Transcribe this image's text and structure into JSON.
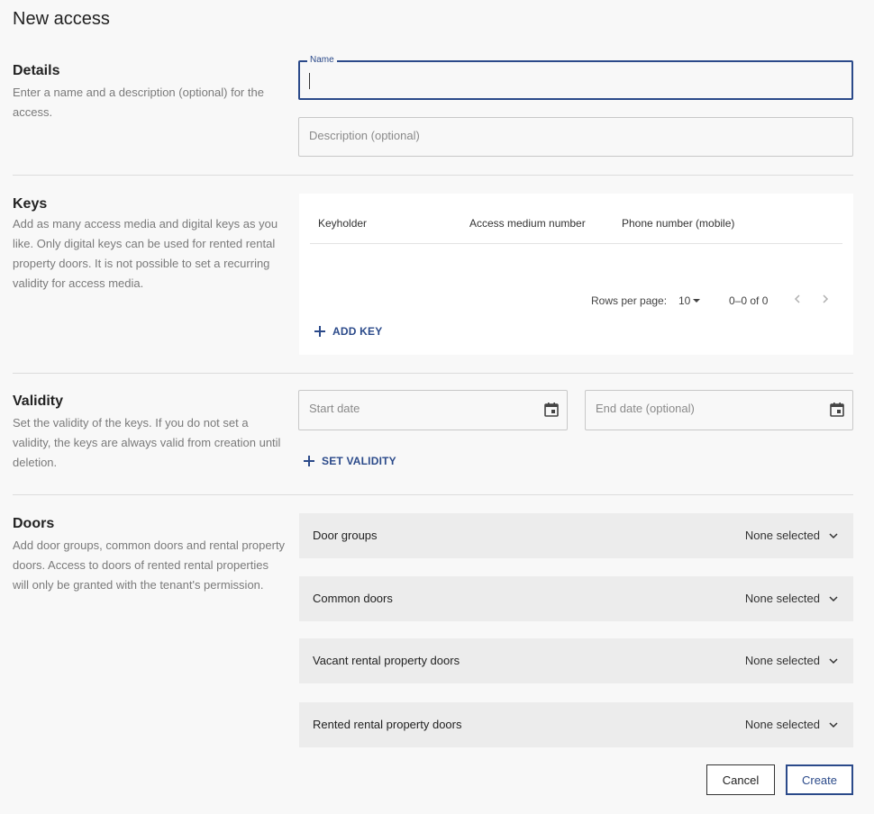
{
  "page": {
    "title": "New access"
  },
  "details": {
    "heading": "Details",
    "description": "Enter a name and a description (optional) for the access.",
    "name_label": "Name",
    "description_placeholder": "Description (optional)"
  },
  "keys": {
    "heading": "Keys",
    "description": "Add as many access media and digital keys as you like. Only digital keys can be used for rented rental property doors. It is not possible to set a recurring validity for access media.",
    "columns": [
      "Keyholder",
      "Access medium number",
      "Phone number (mobile)"
    ],
    "rows_per_page_label": "Rows per page:",
    "rows_per_page_value": "10",
    "range": "0–0 of 0",
    "add_key_label": "ADD KEY"
  },
  "validity": {
    "heading": "Validity",
    "description": "Set the validity of the keys. If you do not set a validity, the keys are always valid from creation until deletion.",
    "start_placeholder": "Start date",
    "end_placeholder": "End date (optional)",
    "set_validity_label": "SET VALIDITY"
  },
  "doors": {
    "heading": "Doors",
    "description": "Add door groups, common doors and rental property doors. Access to doors of rented rental properties will only be granted with the tenant's permission.",
    "rows": [
      {
        "label": "Door groups",
        "value": "None selected"
      },
      {
        "label": "Common doors",
        "value": "None selected"
      },
      {
        "label": "Vacant rental property doors",
        "value": "None selected"
      },
      {
        "label": "Rented rental property doors",
        "value": "None selected"
      }
    ]
  },
  "actions": {
    "cancel": "Cancel",
    "create": "Create"
  },
  "colors": {
    "accent": "#2b4a8a",
    "muted_text": "#7a7a7a",
    "row_bg": "#ececec"
  },
  "icons": [
    "calendar-icon",
    "chevron-down-icon",
    "chevron-left-icon",
    "chevron-right-icon",
    "plus-icon",
    "caret-down-icon"
  ]
}
